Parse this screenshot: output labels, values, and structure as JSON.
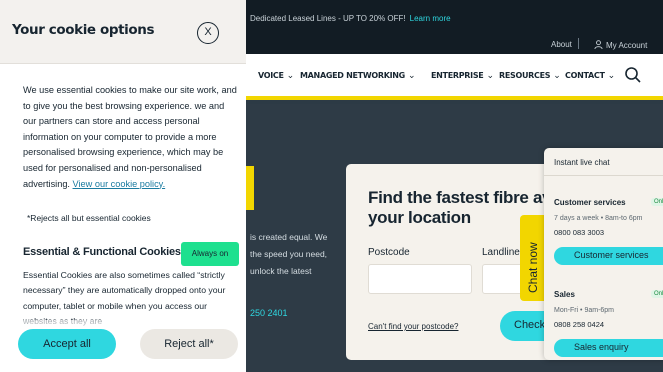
{
  "site": {
    "promo_text": "Dedicated Leased Lines - UP TO 20% OFF!",
    "promo_link": "Learn more",
    "utility": {
      "about": "About",
      "account": "My Account"
    },
    "nav": [
      "VOICE",
      "MANAGED NETWORKING",
      "ENTERPRISE",
      "RESOURCES",
      "CONTACT"
    ],
    "hero_lines": [
      "is created equal. We",
      "the speed you need,",
      "unlock the latest"
    ],
    "hero_phone": "250 2401",
    "accent_color": "#2fd7e0",
    "brand_yellow": "#f2d600"
  },
  "finder": {
    "title_line1": "Find the fastest fibre av",
    "title_line2": "your location",
    "postcode_label": "Postcode",
    "landline_label": "Landline",
    "cant_find": "Can't find your postcode?",
    "check_label": "Check"
  },
  "chat_tab": "Chat now",
  "livechat": {
    "header": "Instant live chat",
    "customer": {
      "title": "Customer services",
      "badge": "Onli",
      "hours": "7 days a week • 8am-to 6pm",
      "number": "0800 083 3003",
      "button": "Customer services"
    },
    "sales": {
      "title": "Sales",
      "badge": "Onli",
      "hours": "Mon-Fri • 9am-6pm",
      "number": "0808 258 0424",
      "button": "Sales enquiry"
    }
  },
  "cookie": {
    "title": "Your cookie options",
    "close_glyph": "X",
    "intro": "We use essential cookies to make our site work, and to give you the best browsing experience. we and our partners can store and access personal information on your computer to provide a more personalised browsing experience, which may be used for personalised and non-personalised advertising.",
    "policy_link": "View our cookie policy.",
    "rejects_note": "*Rejects all but essential cookies",
    "essential_heading": "Essential & Functional Cookies",
    "always_on": "Always on",
    "essential_body": "Essential Cookies are also sometimes called “strictly necessary” they are automatically dropped onto your computer, tablet or mobile when you access our websites as they are",
    "accept_label": "Accept all",
    "reject_label": "Reject all*"
  }
}
